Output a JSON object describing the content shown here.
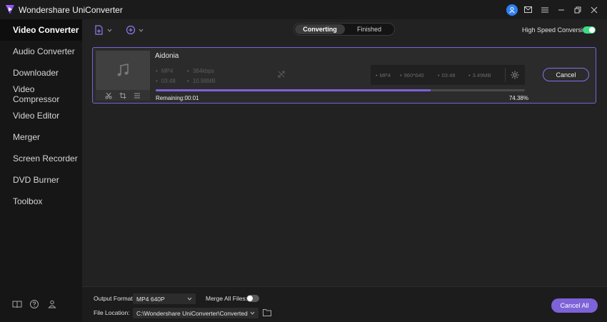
{
  "titlebar": {
    "app_title": "Wondershare UniConverter"
  },
  "sidebar": {
    "items": [
      {
        "label": "Video Converter"
      },
      {
        "label": "Audio Converter"
      },
      {
        "label": "Downloader"
      },
      {
        "label": "Video Compressor"
      },
      {
        "label": "Video Editor"
      },
      {
        "label": "Merger"
      },
      {
        "label": "Screen Recorder"
      },
      {
        "label": "DVD Burner"
      },
      {
        "label": "Toolbox"
      }
    ],
    "active_index": 0
  },
  "toolbar": {
    "tabs": [
      {
        "label": "Converting"
      },
      {
        "label": "Finished"
      }
    ],
    "high_speed_label": "High Speed Conversion",
    "high_speed_enabled": true
  },
  "task": {
    "file_name": "Aidonia",
    "source": {
      "format": "MP4",
      "bitrate": "384kbps",
      "duration": "03:48",
      "size": "10.98MB"
    },
    "target": {
      "format": "MP4",
      "resolution": "960*640",
      "duration": "03:48",
      "size": "3.49MB"
    },
    "cancel_label": "Cancel",
    "remaining": "Remaining:00:01",
    "percent_label": "74.38%",
    "progress": 0.7438
  },
  "footer": {
    "output_format_label": "Output Format:",
    "output_format_value": "MP4 640P",
    "merge_label": "Merge All Files:",
    "merge_enabled": false,
    "file_location_label": "File Location:",
    "file_location_value": "C:\\Wondershare UniConverter\\Converted",
    "cancel_all_label": "Cancel All"
  },
  "colors": {
    "accent": "#7d62d8",
    "toggle_on": "#3ddc84",
    "avatar": "#2f80ed"
  }
}
